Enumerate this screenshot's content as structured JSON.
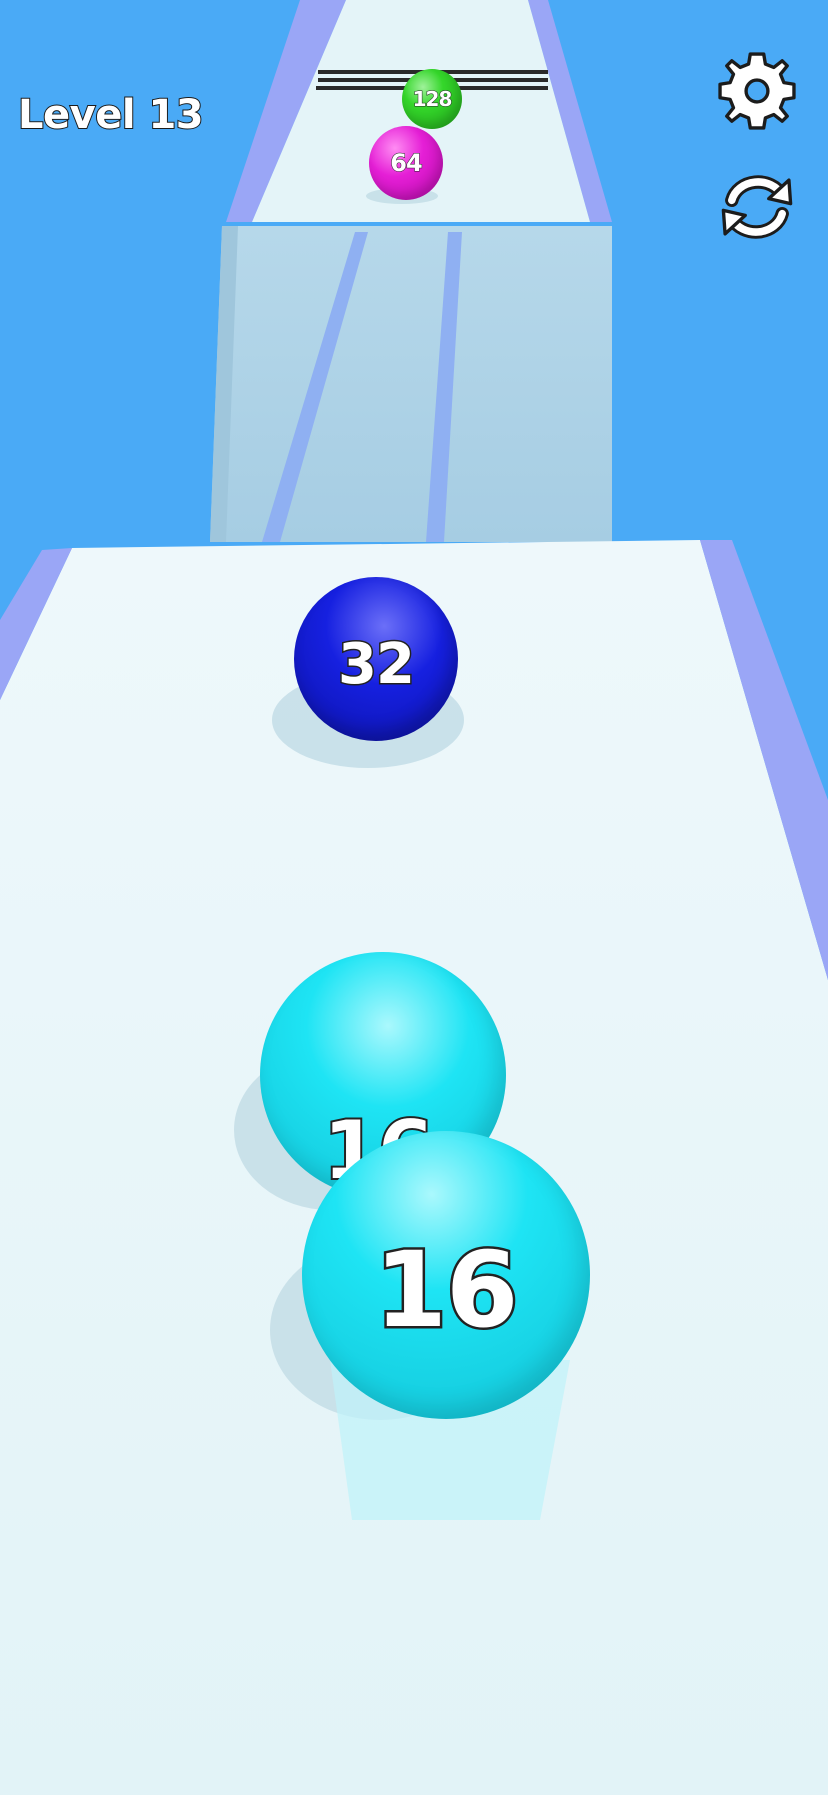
{
  "hud": {
    "level_text": "Level 13"
  },
  "buttons": {
    "settings_icon": "gear-icon",
    "restart_icon": "restart-icon"
  },
  "balls": {
    "ball_128": {
      "label": "128",
      "color": "#34d62a"
    },
    "ball_64": {
      "label": "64",
      "color": "#e51fd6"
    },
    "ball_32": {
      "label": "32",
      "color": "#1620e0"
    },
    "ball_16_back": {
      "label": "16",
      "color": "#1ee4f4"
    },
    "ball_16_front": {
      "label": "16",
      "color": "#1ee4f4"
    }
  },
  "colors": {
    "sky": "#4aaaf6",
    "track": "#dff4f8",
    "rail": "#9aa6f6"
  }
}
